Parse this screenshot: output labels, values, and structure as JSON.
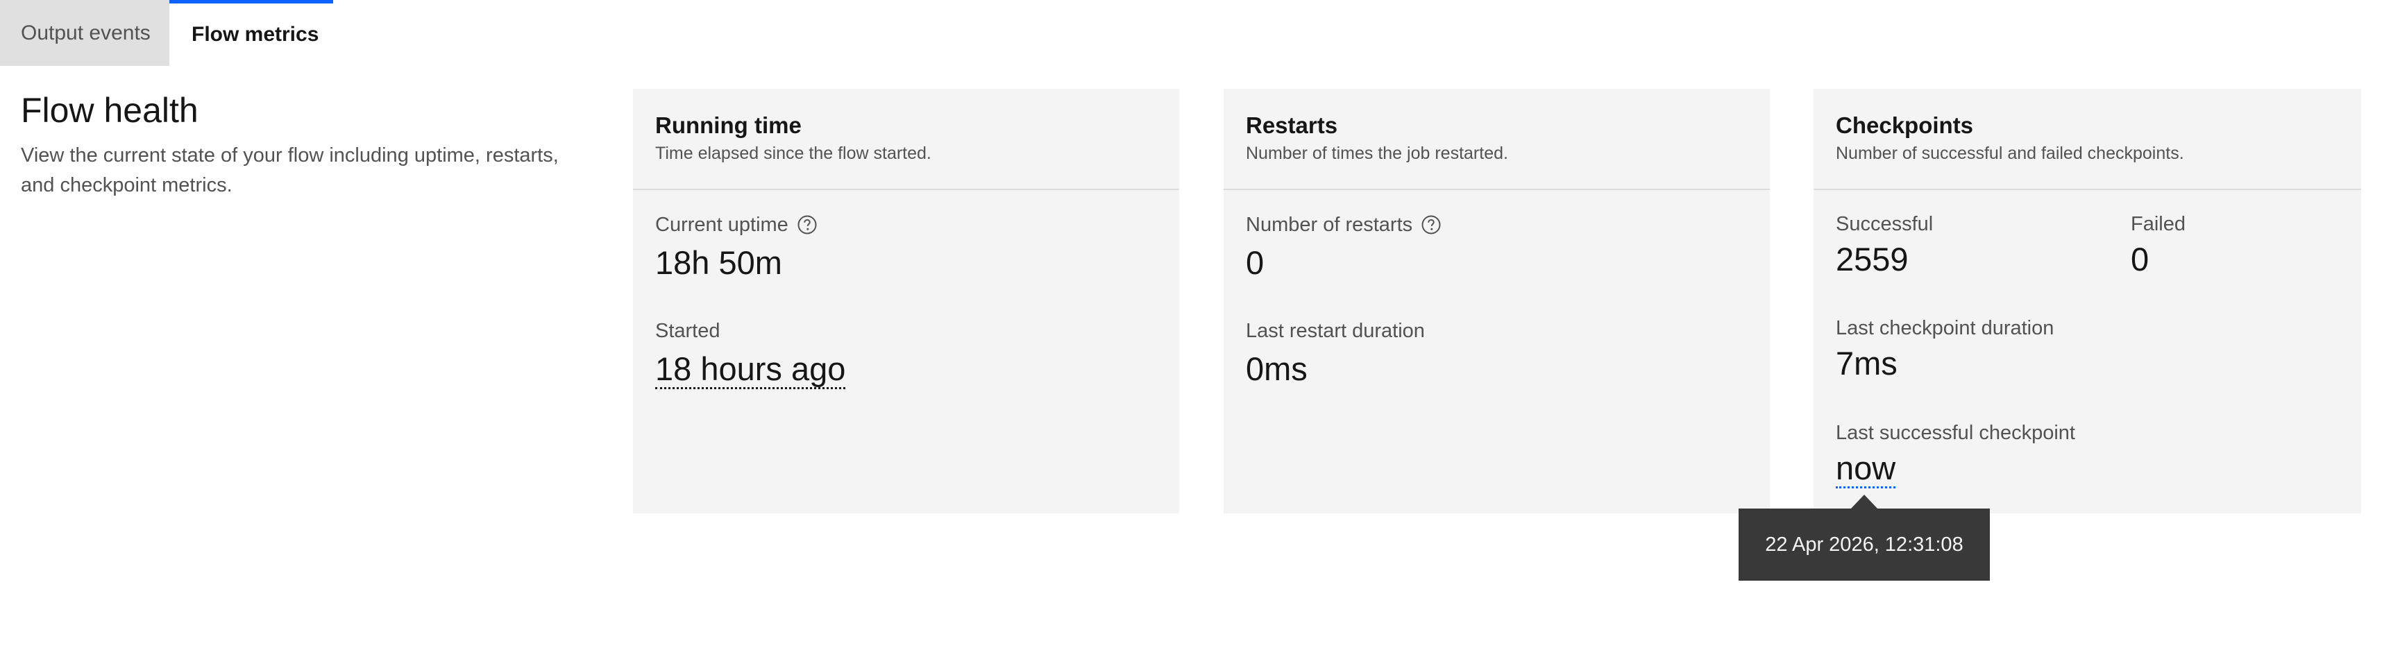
{
  "tabs": {
    "output_events": "Output events",
    "flow_metrics": "Flow metrics"
  },
  "intro": {
    "title": "Flow health",
    "description": "View the current state of your flow including uptime, restarts, and checkpoint metrics."
  },
  "running_time": {
    "title": "Running time",
    "subtitle": "Time elapsed since the flow started.",
    "current_uptime_label": "Current uptime",
    "current_uptime_value": "18h 50m",
    "started_label": "Started",
    "started_value": "18 hours ago"
  },
  "restarts": {
    "title": "Restarts",
    "subtitle": "Number of times the job restarted.",
    "count_label": "Number of restarts",
    "count_value": "0",
    "last_duration_label": "Last restart duration",
    "last_duration_value": "0ms"
  },
  "checkpoints": {
    "title": "Checkpoints",
    "subtitle": "Number of successful and failed checkpoints.",
    "successful_label": "Successful",
    "successful_value": "2559",
    "failed_label": "Failed",
    "failed_value": "0",
    "last_duration_label": "Last checkpoint duration",
    "last_duration_value": "7ms",
    "last_successful_label": "Last successful checkpoint",
    "last_successful_value": "now"
  },
  "tooltip": {
    "text": "22 Apr 2026, 12:31:08"
  },
  "icons": {
    "help": "help-circle-icon"
  },
  "colors": {
    "accent": "#0f62fe",
    "card_bg": "#f4f4f4",
    "tooltip_bg": "#393939",
    "inactive_tab_bg": "#e0e0e0"
  }
}
